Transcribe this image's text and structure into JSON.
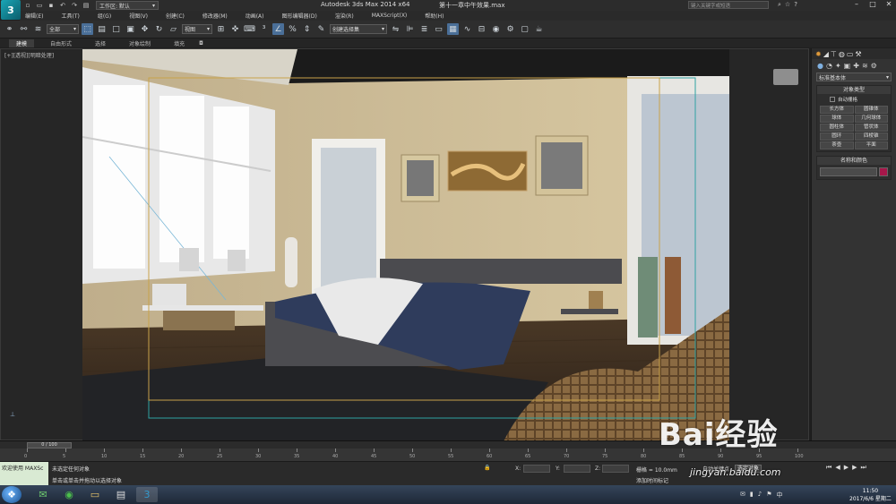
{
  "app": {
    "logo_letter": "3",
    "title": "Autodesk 3ds Max  2014 x64",
    "file": "第十一章中午效果.max",
    "workspace": "工作区: 默认",
    "search_placeholder": "键入关键字或短语"
  },
  "menu": [
    "编辑(E)",
    "工具(T)",
    "组(G)",
    "视图(V)",
    "创建(C)",
    "修改器(M)",
    "动画(A)",
    "图形编辑器(D)",
    "渲染(R)",
    "MAXScript(X)",
    "帮助(H)"
  ],
  "toolbar": {
    "filter": "全部",
    "refcoord": "视图",
    "named_sel": "创建选择集"
  },
  "ribbon": {
    "tabs": [
      "建模",
      "自由形式",
      "选择",
      "对象绘制",
      "填充"
    ],
    "active": 0
  },
  "viewport": {
    "label": "[+][透视][明暗处理]"
  },
  "command_panel": {
    "category": "标准基本体",
    "object_type_header": "对象类型",
    "autogrid": "自动栅格",
    "buttons": [
      "长方体",
      "圆锥体",
      "球体",
      "几何球体",
      "圆柱体",
      "管状体",
      "圆环",
      "四棱锥",
      "茶壶",
      "平面"
    ],
    "name_color_header": "名称和颜色",
    "color": "#a6174a"
  },
  "timeline": {
    "slider": "0 / 100",
    "ticks": [
      0,
      5,
      10,
      15,
      20,
      25,
      30,
      35,
      40,
      45,
      50,
      55,
      60,
      65,
      70,
      75,
      80,
      85,
      90,
      95,
      100
    ]
  },
  "status": {
    "maxscript": "欢迎使用 MAXSc",
    "msg1": "未选定任何对象",
    "msg2": "单击或单击并拖动以选择对象",
    "x": "X:",
    "y": "Y:",
    "z": "Z:",
    "grid": "栅格 = 10.0mm",
    "add_time_tag": "添加时间标记",
    "autokey": "自动关键点",
    "sel_obj": "选定对象",
    "set_key": "设置关键点",
    "key_filter": "关键点过滤器..."
  },
  "taskbar": {
    "time": "11:50",
    "date": "2017/6/6 星期二"
  },
  "watermark": {
    "text": "Bai经验",
    "url": "jingyan.baidu.com"
  }
}
